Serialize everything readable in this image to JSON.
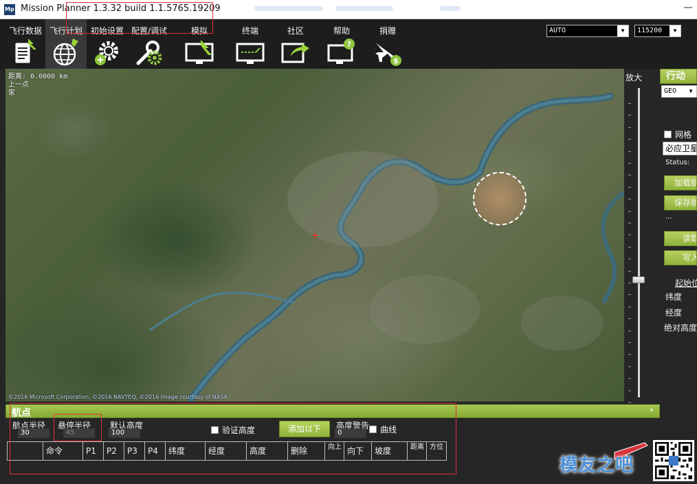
{
  "window": {
    "title": "Mission Planner 1.3.32 build 1.1.5765.19209",
    "logo": "Mp",
    "minimize": "—"
  },
  "nav": [
    {
      "label": "飞行数据",
      "icon": "flight-data-icon"
    },
    {
      "label": "飞行计划",
      "icon": "flight-plan-globe-icon"
    },
    {
      "label": "初始设置",
      "icon": "initial-setup-gear-icon"
    },
    {
      "label": "配置/调试",
      "icon": "config-tuning-wrench-icon"
    },
    {
      "label": "模拟",
      "icon": "simulation-monitor-icon"
    },
    {
      "label": "终端",
      "icon": "terminal-icon"
    },
    {
      "label": "社区",
      "icon": "community-share-icon"
    },
    {
      "label": "帮助",
      "icon": "help-monitor-icon"
    },
    {
      "label": "捐赠",
      "icon": "donate-plane-icon"
    }
  ],
  "connection": {
    "port": "AUTO",
    "baud": "115200"
  },
  "map": {
    "distance": "距离: 0.0000 km",
    "prev_point": "上一点",
    "home": "家",
    "copyright": "©2016 Microsoft Corporation, ©2016 NAVTEQ, ©2016 Image courtesy of NASA"
  },
  "zoom": {
    "label": "放大",
    "level": 0.62
  },
  "right_panel": {
    "header": "行动",
    "coord_system": "GEO",
    "grid_label": "网格",
    "map_provider": "必应卫星",
    "status": "Status:",
    "load_button": "加载航",
    "save_button": "保存航",
    "ellipsis": "...",
    "read_button": "读取",
    "write_button": "写入",
    "start_label": "起始位",
    "lat_label": "纬度",
    "lon_label": "经度",
    "alt_label": "绝对高度"
  },
  "waypoints": {
    "header": "航点",
    "collapse": "»",
    "wp_radius_label": "航点半径",
    "wp_radius_value": "30",
    "loiter_radius_label": "悬停半径",
    "loiter_radius_value": "45",
    "default_alt_label": "默认高度",
    "default_alt_value": "100",
    "verify_height_label": "验证高度",
    "add_below_button": "添加以下",
    "alt_warning_label": "高度警告",
    "alt_warning_value": "0",
    "spline_label": "曲线",
    "columns": [
      "",
      "命令",
      "P1",
      "P2",
      "P3",
      "P4",
      "纬度",
      "经度",
      "高度",
      "删除",
      "向上",
      "向下",
      "坡度",
      "距离",
      "方位"
    ]
  },
  "watermark": {
    "text": "模友之吧"
  },
  "colors": {
    "accent_green": "#9bbd44",
    "highlight_red": "#e0303a",
    "background_dark": "#262626"
  }
}
